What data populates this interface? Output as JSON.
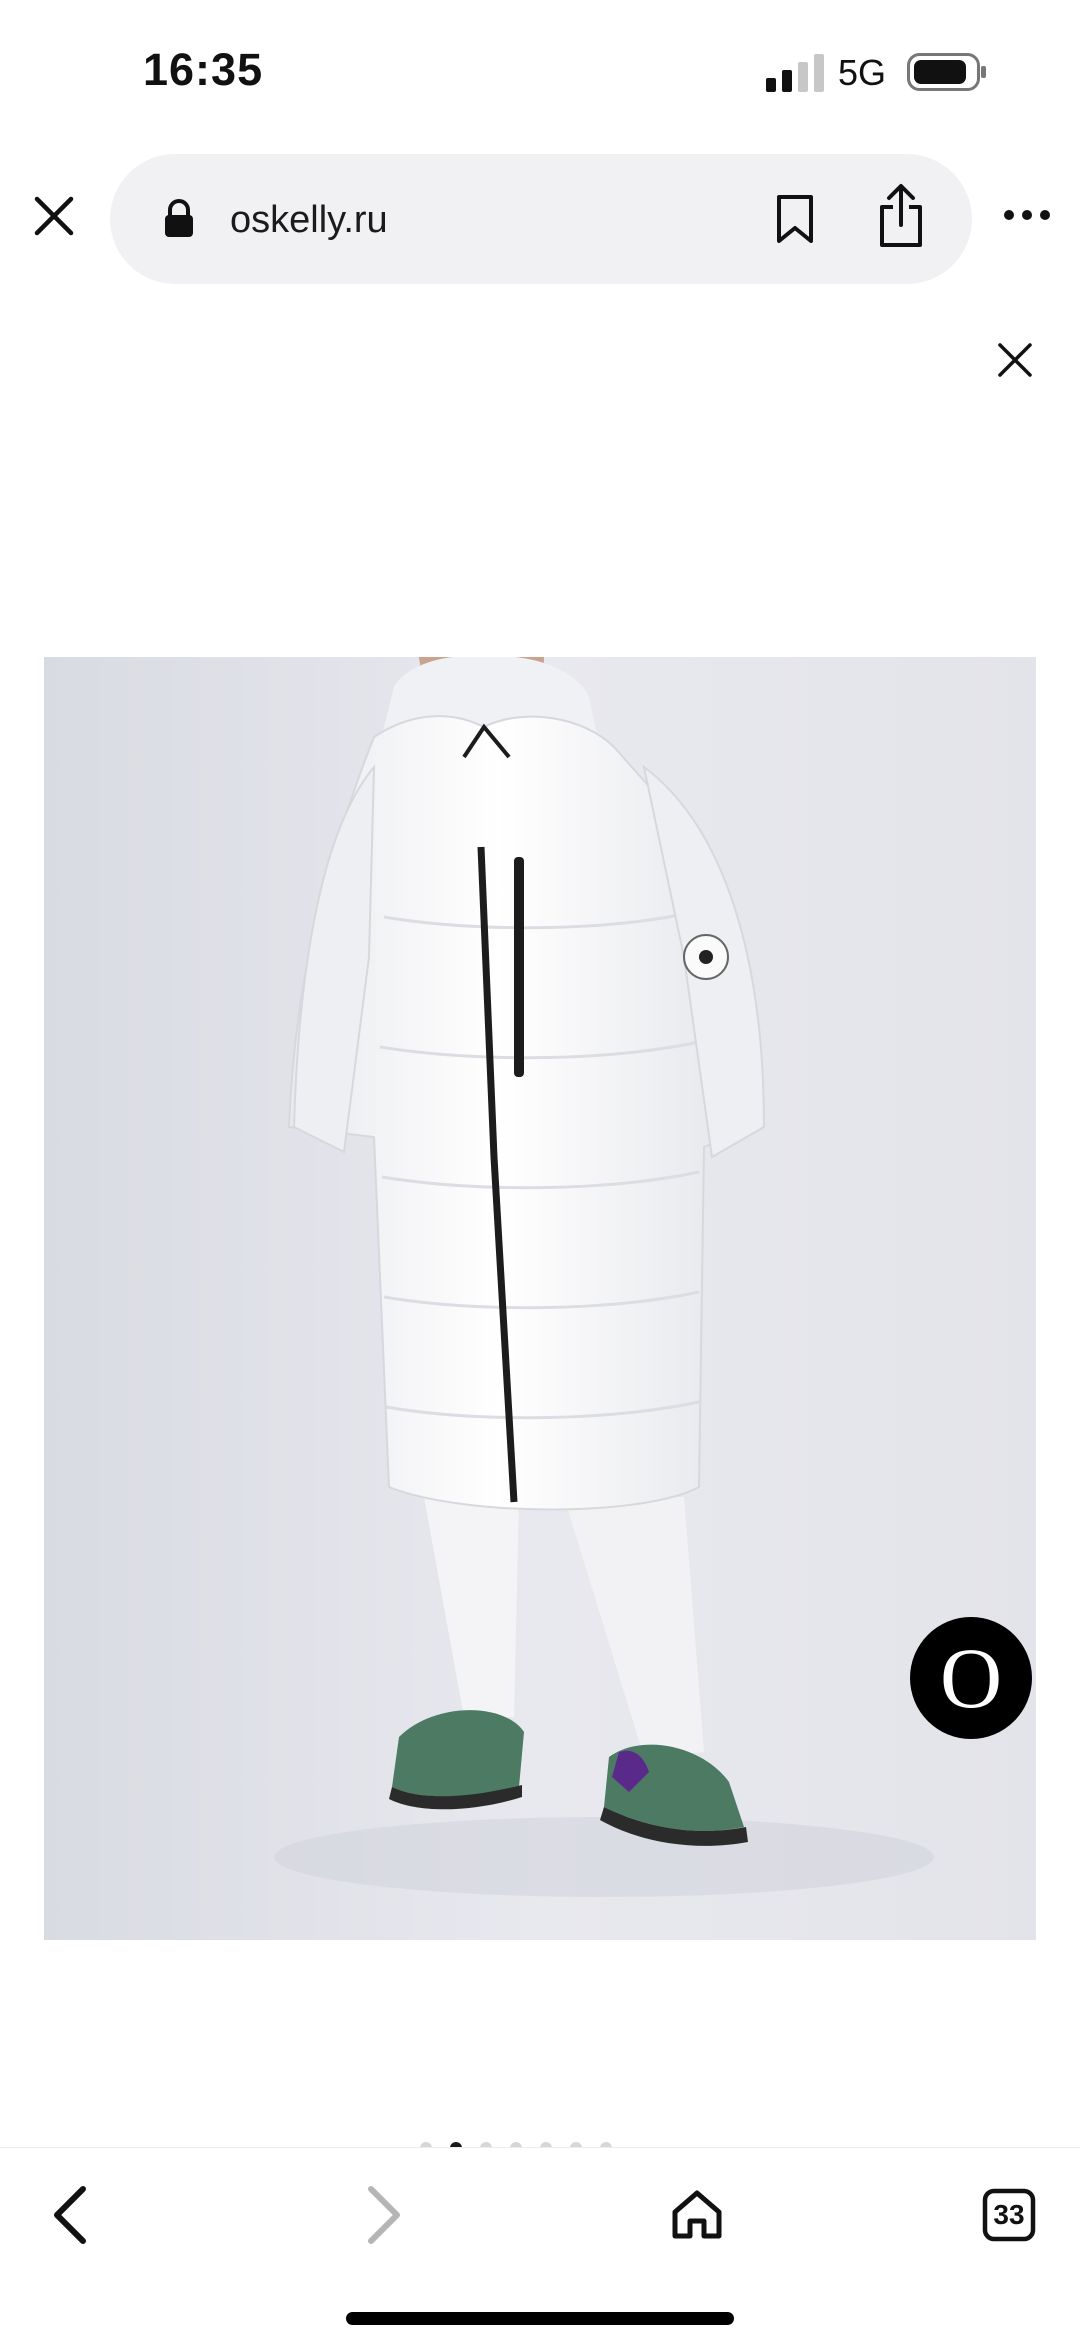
{
  "status": {
    "time": "16:35",
    "network": "5G",
    "icons": [
      "signal-icon",
      "battery-icon"
    ]
  },
  "browser": {
    "url": "oskelly.ru",
    "tab_count": "33",
    "icons": [
      "close-icon",
      "lock-icon",
      "bookmark-icon",
      "share-icon",
      "more-icon",
      "back-icon",
      "forward-icon",
      "home-icon",
      "tabs-icon"
    ]
  },
  "product": {
    "brand_logo_letter": "O",
    "image_subject": "white long puffer coat",
    "gallery_dots_total": 7,
    "gallery_dot_active": 2
  },
  "colors": {
    "accent": "#000000",
    "image_background": "#e2e3e9",
    "url_bar": "#f1f1f3"
  }
}
